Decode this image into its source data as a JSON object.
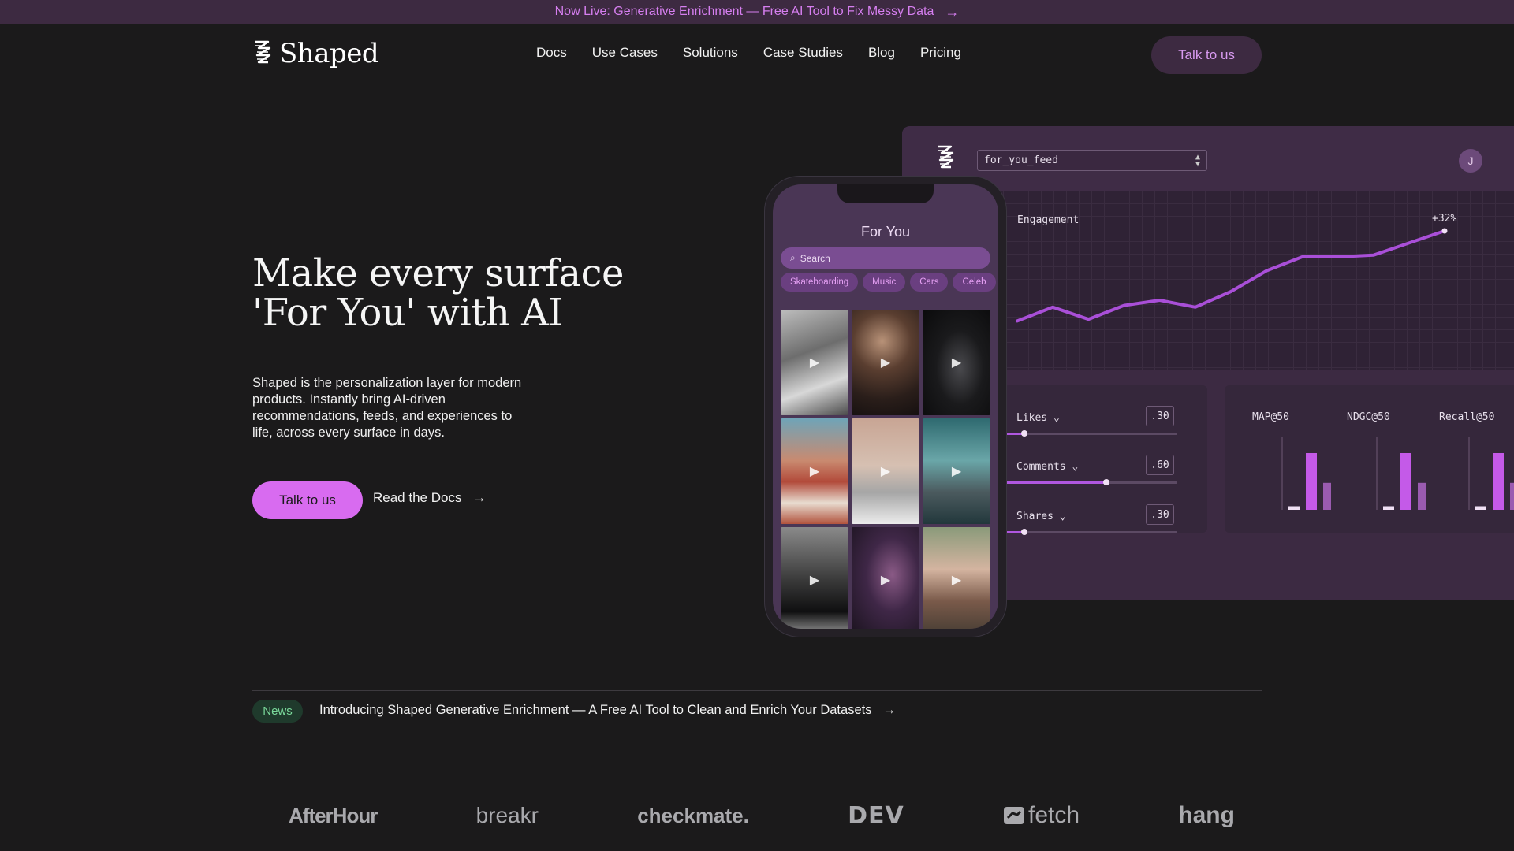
{
  "banner": {
    "text": "Now Live: Generative Enrichment — Free AI Tool to Fix Messy Data",
    "arrow": "→"
  },
  "nav": {
    "brand": "Shaped",
    "links": [
      "Docs",
      "Use Cases",
      "Solutions",
      "Case Studies",
      "Blog",
      "Pricing"
    ],
    "cta": "Talk to us"
  },
  "hero": {
    "title": "Make every surface 'For You' with AI",
    "description": "Shaped is the personalization layer for modern products. Instantly bring AI-driven recommendations, feeds, and experiences to life, across every surface in days.",
    "cta": "Talk to us",
    "docs_link": "Read the Docs",
    "arrow": "→"
  },
  "dashboard": {
    "select_value": "for_you_feed",
    "avatar_initial": "J",
    "chart": {
      "label": "Engagement",
      "delta": "+32%",
      "values": [
        0.18,
        0.26,
        0.19,
        0.27,
        0.3,
        0.26,
        0.35,
        0.47,
        0.55,
        0.55,
        0.56,
        0.63,
        0.7
      ]
    },
    "weights": [
      {
        "name": "Likes",
        "value": ".30",
        "level": 0.12
      },
      {
        "name": "Comments",
        "value": ".60",
        "level": 0.48
      },
      {
        "name": "Shares",
        "value": ".30",
        "level": 0.12
      }
    ],
    "metrics": [
      {
        "name": "MAP@50",
        "bars": [
          0.05,
          0.8,
          0.38
        ]
      },
      {
        "name": "NDGC@50",
        "bars": [
          0.05,
          0.8,
          0.38
        ]
      },
      {
        "name": "Recall@50",
        "bars": [
          0.05,
          0.8,
          0.38
        ]
      }
    ]
  },
  "phone": {
    "title": "For You",
    "search_placeholder": "Search",
    "chips": [
      "Skateboarding",
      "Music",
      "Cars",
      "Celeb"
    ],
    "tiles": [
      "video-1",
      "video-2",
      "video-3",
      "video-4",
      "video-5",
      "video-6",
      "video-7",
      "video-8",
      "video-9"
    ],
    "play_glyph": "▶"
  },
  "news": {
    "badge": "News",
    "text": "Introducing Shaped Generative Enrichment — A Free AI Tool to Clean and Enrich Your Datasets",
    "arrow": "→"
  },
  "logos": [
    "AfterHour",
    "breakr",
    "checkmate.",
    "DEV",
    "fetch",
    "hang"
  ],
  "colors": {
    "accent": "#d86bf0",
    "banner_bg": "#3d2a41",
    "page_bg": "#1b1a1b",
    "news_green": "#7ad89a"
  }
}
